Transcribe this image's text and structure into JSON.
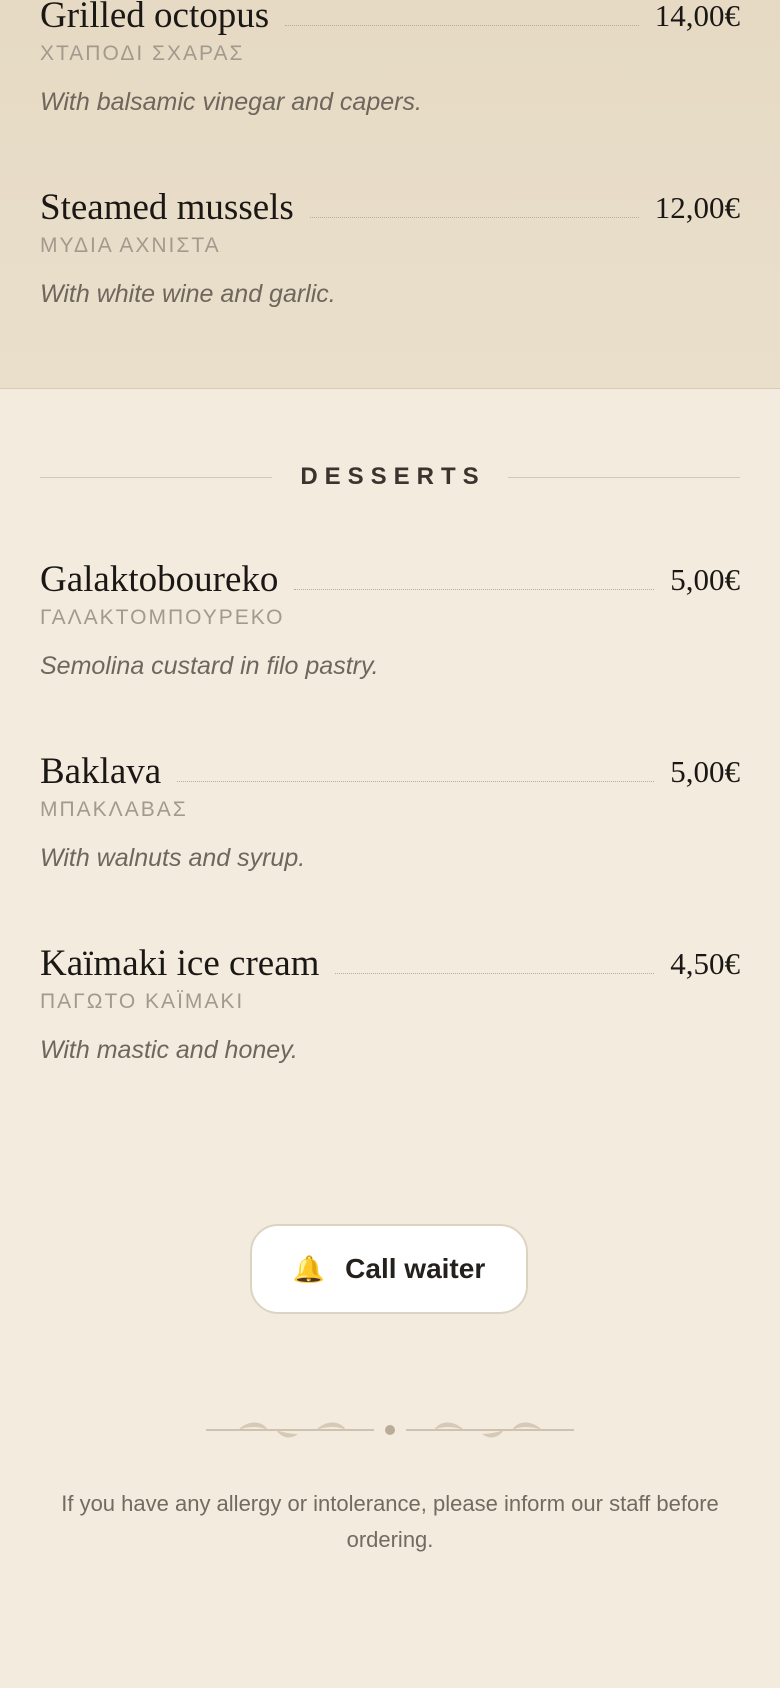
{
  "starters": {
    "items": [
      {
        "name": "Grilled octopus",
        "price": "14,00€",
        "greek": "ΧΤΑΠΟΔΙ ΣΧΑΡΑΣ",
        "description": "With balsamic vinegar and capers."
      },
      {
        "name": "Steamed mussels",
        "price": "12,00€",
        "greek": "ΜΥΔΙΑ ΑΧΝΙΣΤΑ",
        "description": "With white wine and garlic."
      }
    ]
  },
  "desserts": {
    "title": "DESSERTS",
    "items": [
      {
        "name": "Galaktoboureko",
        "price": "5,00€",
        "greek": "ΓΑΛΑΚΤΟΜΠΟΥΡΕΚΟ",
        "description": "Semolina custard in filo pastry."
      },
      {
        "name": "Baklava",
        "price": "5,00€",
        "greek": "ΜΠΑΚΛΑΒΑΣ",
        "description": "With walnuts and syrup."
      },
      {
        "name": "Kaïmaki ice cream",
        "price": "4,50€",
        "greek": "ΠΑΓΩΤΟ ΚΑΪΜΑΚΙ",
        "description": "With mastic and honey."
      }
    ]
  },
  "call_waiter": {
    "label": "Call waiter",
    "icon": "bell-icon"
  },
  "footer": {
    "note": "If you have any allergy or intolerance, please inform our staff before ordering."
  },
  "colors": {
    "accent": "#e0a030",
    "background": "#f3ebde",
    "section_background": "#e8dcc6"
  }
}
